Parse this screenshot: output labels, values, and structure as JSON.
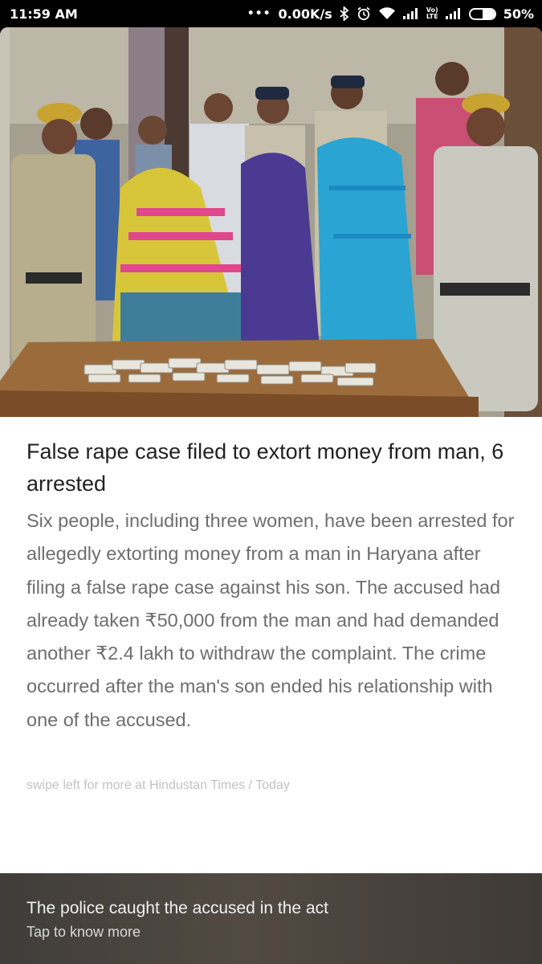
{
  "status_bar": {
    "time": "11:59 AM",
    "network_speed": "0.00K/s",
    "icons": [
      "more-dots-icon",
      "bluetooth-icon",
      "alarm-icon",
      "wifi-icon",
      "signal-icon",
      "volte-icon",
      "signal-icon",
      "battery-icon"
    ],
    "volte_label_top": "Vo)",
    "volte_label_bottom": "LTE",
    "battery_text": "50%",
    "battery_level": 0.5
  },
  "article": {
    "image_icon": "news-photo",
    "headline": "False rape case filed to extort money from man, 6 arrested",
    "summary": "Six people, including three women, have been arrested for allegedly extorting money from a man in Haryana after filing a false rape case against his son. The accused had already taken ₹50,000 from the man and had demanded another ₹2.4 lakh to withdraw the complaint. The crime occurred after the man's son ended his relationship with one of the accused.",
    "source_line": "swipe left for more at Hindustan Times / Today"
  },
  "footer": {
    "title": "The police caught the accused in the act",
    "subtitle": "Tap to know more"
  }
}
